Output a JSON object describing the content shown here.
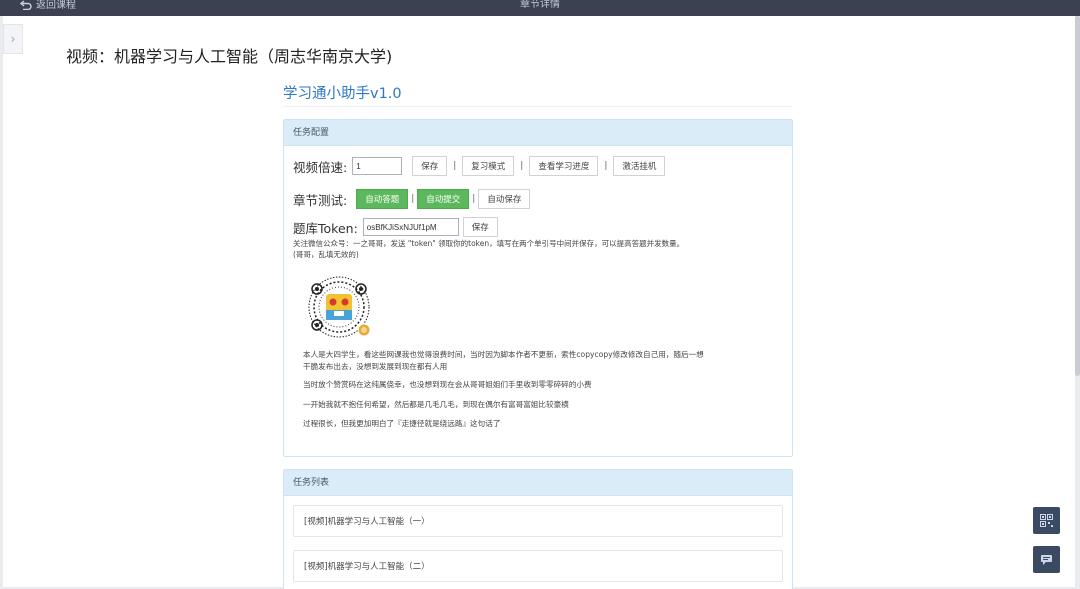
{
  "topbar": {
    "back_label": "返回课程",
    "title": "章节详情"
  },
  "page": {
    "title": "视频：机器学习与人工智能（周志华南京大学)",
    "toggle_glyph": "›"
  },
  "helper": {
    "title": "学习通小助手v1.0"
  },
  "config": {
    "header": "任务配置",
    "speed": {
      "label": "视频倍速:",
      "value": "1",
      "save": "保存",
      "review_mode": "复习模式",
      "view_progress": "查看学习进度",
      "activate": "激活挂机",
      "sep": "|"
    },
    "chapter_test": {
      "label": "章节测试:",
      "auto_answer": "自动答题",
      "auto_submit": "自动提交",
      "auto_save": "自动保存",
      "sep": "|"
    },
    "token": {
      "label": "题库Token:",
      "value": "osBfKJiSxNJUf1pM",
      "save": "保存"
    },
    "notes": [
      "关注微信公众号：一之哥哥，发送 \"token\" 领取你的token，填写在两个单引号中间并保存，可以提高答题并发数量。",
      "(哥哥，乱填无效的)"
    ],
    "paragraphs": [
      "本人是大四学生，看这些网课我也觉得浪费时间，当时因为脚本作者不更新，索性copycopy修改修改自己用，随后一想",
      "干脆发布出去，没想到发展到现在都有人用",
      "当时放个赞赏码在这纯属侥幸，也没想到现在会从哥哥姐姐们手里收到零零碎碎的小费",
      "一开始我就不抱任何希望，然后都是几毛几毛，到现在偶尔有富哥富姐比较豪横",
      "过程很长，但我更加明白了『走捷径就是绕远路』这句话了"
    ]
  },
  "tasks": {
    "header": "任务列表",
    "items": [
      "[视频]机器学习与人工智能（一）",
      "[视频]机器学习与人工智能（二）"
    ]
  },
  "colors": {
    "topbar": "#3a4252",
    "accent_blue": "#2e77c2",
    "panel_header": "#d9ecf8",
    "green_button": "#5cb85c",
    "float_button": "#3a4a63"
  },
  "icons": {
    "back": "return-arrow-icon",
    "qr": "qr-code-icon",
    "float_qr": "qr-icon",
    "float_chat": "chat-icon"
  }
}
